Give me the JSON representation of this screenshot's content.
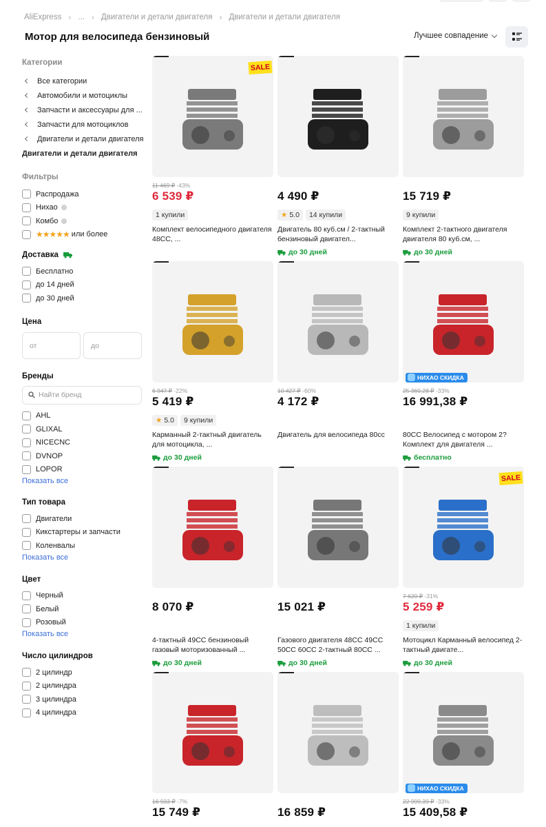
{
  "breadcrumb": [
    {
      "label": "AliExpress"
    },
    {
      "label": "..."
    },
    {
      "label": "Двигатели и детали двигателя"
    },
    {
      "label": "Двигатели и детали двигателя"
    }
  ],
  "page_title": "Мотор для велосипеда бензиновый",
  "sort": {
    "label": "Лучшее совпадение"
  },
  "sidebar": {
    "categories_title": "Категории",
    "categories": [
      {
        "label": "Все категории"
      },
      {
        "label": "Автомобили и мотоциклы"
      },
      {
        "label": "Запчасти и аксессуары для ..."
      },
      {
        "label": "Запчасти для мотоциклов"
      },
      {
        "label": "Двигатели и детали двигателя"
      }
    ],
    "current_category": "Двигатели и детали двигателя",
    "filters_title": "Фильтры",
    "filters": [
      {
        "label": "Распродажа"
      },
      {
        "label": "Нихао"
      },
      {
        "label": "Комбо"
      },
      {
        "label": "или более"
      }
    ],
    "delivery_title": "Доставка",
    "delivery": [
      {
        "label": "Бесплатно"
      },
      {
        "label": "до 14 дней"
      },
      {
        "label": "до 30 дней"
      }
    ],
    "price_title": "Цена",
    "price_from_placeholder": "от",
    "price_to_placeholder": "до",
    "brands_title": "Бренды",
    "brand_search_placeholder": "Найти бренд",
    "brands": [
      {
        "label": "AHL"
      },
      {
        "label": "GLIXAL"
      },
      {
        "label": "NICECNC"
      },
      {
        "label": "DVNOP"
      },
      {
        "label": "LOPOR"
      }
    ],
    "show_all": "Показать все",
    "type_title": "Тип товара",
    "types": [
      {
        "label": "Двигатели"
      },
      {
        "label": "Кикстартеры и запчасти"
      },
      {
        "label": "Коленвалы"
      }
    ],
    "color_title": "Цвет",
    "colors": [
      {
        "label": "Черный"
      },
      {
        "label": "Белый"
      },
      {
        "label": "Розовый"
      }
    ],
    "cylinders_title": "Число цилиндров",
    "cylinders": [
      {
        "label": "2 цилиндр"
      },
      {
        "label": "2 цилиндра"
      },
      {
        "label": "3 цилиндра"
      },
      {
        "label": "4 цилиндра"
      }
    ]
  },
  "products": [
    {
      "old_price": "11 469 ₽",
      "discount": "-43%",
      "price": "6 539 ₽",
      "price_red": true,
      "badge": "SALE",
      "sold": "1 купили",
      "rating": "",
      "title": "Комплект велосипедного двигателя 48CC, ...",
      "shipping": ""
    },
    {
      "old_price": "",
      "discount": "",
      "price": "4 490 ₽",
      "price_red": false,
      "badge": "",
      "sold": "14 купили",
      "rating": "5.0",
      "title": "Двигатель 80 куб.см / 2-тактный бензиновый двигател...",
      "shipping": "до 30 дней"
    },
    {
      "old_price": "",
      "discount": "",
      "price": "15 719 ₽",
      "price_red": false,
      "badge": "",
      "sold": "9 купили",
      "rating": "",
      "title": "Комплект 2-тактного двигателя двигателя 80 куб.см, ...",
      "shipping": "до 30 дней"
    },
    {
      "old_price": "6 947 ₽",
      "discount": "-22%",
      "price": "5 419 ₽",
      "price_red": false,
      "badge": "",
      "sold": "9 купили",
      "rating": "5.0",
      "title": "Карманный 2-тактный двигатель для мотоцикла, ...",
      "shipping": "до 30 дней"
    },
    {
      "old_price": "10 427 ₽",
      "discount": "-60%",
      "price": "4 172 ₽",
      "price_red": false,
      "badge": "",
      "sold": "",
      "rating": "",
      "title": "Двигатель для велосипеда 80cc",
      "shipping": ""
    },
    {
      "old_price": "25 360,28 ₽",
      "discount": "-33%",
      "price": "16 991,38 ₽",
      "price_red": false,
      "badge": "НИХАО СКИДКА",
      "sold": "",
      "rating": "",
      "title": "80CC Велосипед с мотором 2? Комплект для двигателя ...",
      "shipping": "бесплатно"
    },
    {
      "old_price": "",
      "discount": "",
      "price": "8 070 ₽",
      "price_red": false,
      "badge": "",
      "sold": "",
      "rating": "",
      "title": "4-тактный 49CC бензиновый газовый моторизованный ...",
      "shipping": "до 30 дней"
    },
    {
      "old_price": "",
      "discount": "",
      "price": "15 021 ₽",
      "price_red": false,
      "badge": "",
      "sold": "",
      "rating": "",
      "title": "Газового двигателя 48CC 49CC 50CC 60CC 2-тактный 80CC ...",
      "shipping": "до 30 дней"
    },
    {
      "old_price": "7 620 ₽",
      "discount": "-31%",
      "price": "5 259 ₽",
      "price_red": true,
      "badge": "SALE",
      "sold": "1 купили",
      "rating": "",
      "title": "Мотоцикл Карманный велосипед 2-тактный двигате...",
      "shipping": "до 30 дней"
    },
    {
      "old_price": "16 933 ₽",
      "discount": "-7%",
      "price": "15 749 ₽",
      "price_red": false,
      "badge": "",
      "sold": "",
      "rating": "",
      "title": "",
      "shipping": ""
    },
    {
      "old_price": "",
      "discount": "",
      "price": "16 859 ₽",
      "price_red": false,
      "badge": "",
      "sold": "",
      "rating": "",
      "title": "",
      "shipping": ""
    },
    {
      "old_price": "22 999,39 ₽",
      "discount": "-33%",
      "price": "15 409,58 ₽",
      "price_red": false,
      "badge": "НИХАО СКИДКА",
      "sold": "",
      "rating": "",
      "title": "",
      "shipping": ""
    }
  ],
  "colors": {
    "accent_red": "#e0293c",
    "link_blue": "#3d6ed8",
    "ship_green": "#1a9c3c",
    "star": "#f3a21b"
  }
}
